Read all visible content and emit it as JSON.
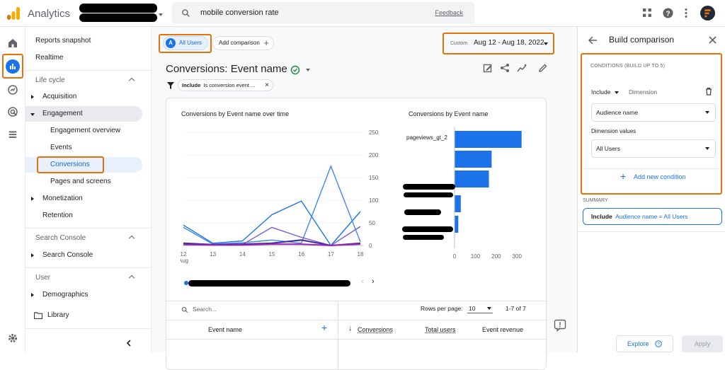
{
  "app": {
    "title": "Analytics"
  },
  "search": {
    "query": "mobile conversion rate",
    "feedback": "Feedback"
  },
  "nav": {
    "reports_snapshot": "Reports snapshot",
    "realtime": "Realtime",
    "lifecycle": "Life cycle",
    "acquisition": "Acquisition",
    "engagement": "Engagement",
    "engagement_overview": "Engagement overview",
    "events": "Events",
    "conversions": "Conversions",
    "pages_and_screens": "Pages and screens",
    "monetization": "Monetization",
    "retention": "Retention",
    "search_console_section": "Search Console",
    "search_console": "Search Console",
    "user_section": "User",
    "demographics": "Demographics",
    "library": "Library"
  },
  "toolbar": {
    "all_users_avatar": "A",
    "all_users": "All Users",
    "add_comparison": "Add comparison",
    "date_prefix": "Custom",
    "date_range": "Aug 12 - Aug 18, 2022"
  },
  "report": {
    "title": "Conversions: Event name",
    "filter_include": "Include",
    "filter_text": "Is conversion event ..."
  },
  "chart_data": [
    {
      "type": "line",
      "title": "Conversions by Event name over time",
      "x": [
        "12",
        "13",
        "14",
        "15",
        "16",
        "17",
        "18"
      ],
      "x_sublabel": "Aug",
      "ylim": [
        0,
        250
      ],
      "yticks": [
        "250",
        "200",
        "150",
        "100",
        "50",
        "0"
      ],
      "series": [
        {
          "color": "#1a73e8",
          "values": [
            45,
            5,
            10,
            68,
            98,
            0,
            75
          ]
        },
        {
          "color": "#4285f4",
          "values": [
            40,
            3,
            6,
            12,
            5,
            175,
            8
          ]
        },
        {
          "color": "#7b5cd6",
          "values": [
            5,
            2,
            2,
            40,
            18,
            0,
            42
          ]
        },
        {
          "color": "#3f2a9e",
          "values": [
            5,
            2,
            3,
            5,
            12,
            0,
            5
          ]
        },
        {
          "color": "#9c27b0",
          "values": [
            2,
            1,
            1,
            3,
            3,
            0,
            3
          ]
        }
      ]
    },
    {
      "type": "bar",
      "orientation": "horizontal",
      "title": "Conversions by Event name",
      "categories": [
        "pageviews_gt_2",
        "",
        "",
        "",
        ""
      ],
      "values": [
        322,
        178,
        165,
        30,
        18
      ],
      "xlim": [
        0,
        340
      ],
      "xticks": [
        "0",
        "100",
        "200",
        "300"
      ],
      "color": "#1a73e8"
    }
  ],
  "table": {
    "search_placeholder": "Search...",
    "rows_per_page_label": "Rows per page:",
    "rows_per_page": "10",
    "pagination": "1-7 of 7",
    "columns": [
      "Event name",
      "Conversions",
      "Total users",
      "Event revenue"
    ]
  },
  "panel": {
    "title": "Build comparison",
    "conditions_label": "CONDITIONS (BUILD UP TO 5)",
    "include": "Include",
    "dimension": "Dimension",
    "audience_name": "Audience name",
    "dimension_values": "Dimension values",
    "all_users": "All Users",
    "add_condition": "Add new condition",
    "summary_label": "SUMMARY",
    "summary_include": "Include",
    "summary_text": "Audience name = All Users",
    "explore": "Explore",
    "apply": "Apply"
  },
  "colors": {
    "accent": "#1a73e8",
    "highlight": "#e8710a",
    "analytics_orange": "#f9ab00"
  }
}
